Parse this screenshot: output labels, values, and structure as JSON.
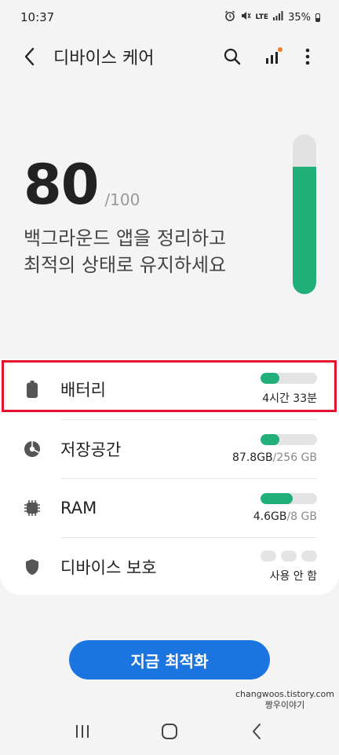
{
  "status_bar": {
    "time": "10:37",
    "network": "LTE",
    "battery_percent": "35%",
    "icons": [
      "alarm-icon",
      "mute-icon",
      "lte-icon",
      "signal-icon",
      "battery-icon"
    ]
  },
  "app_bar": {
    "title": "디바이스 케어",
    "icons": [
      "back-icon",
      "search-icon",
      "stats-icon",
      "more-vert-icon"
    ]
  },
  "score": {
    "value": "80",
    "max": "/100",
    "gauge_fraction": 0.8,
    "gauge_color": "#21b07a",
    "description_line1": "백그라운드 앱을 정리하고",
    "description_line2": "최적의 상태로 유지하세요"
  },
  "items": [
    {
      "label": "배터리",
      "icon": "battery-icon",
      "value": "4시간 33분",
      "value_sub": "",
      "level": 0.33
    },
    {
      "label": "저장공간",
      "icon": "storage-pie-icon",
      "value": "87.8GB",
      "value_sub": "/256 GB",
      "level": 0.34
    },
    {
      "label": "RAM",
      "icon": "ram-chip-icon",
      "value": "4.6GB",
      "value_sub": "/8 GB",
      "level": 0.57
    },
    {
      "label": "디바이스 보호",
      "icon": "shield-icon",
      "value": "사용 안 함",
      "value_sub": "",
      "level": 0
    }
  ],
  "optimize_button": {
    "label": "지금 최적화",
    "color": "#1b75e0"
  },
  "watermark": {
    "line1": "changwoos.tistory.com",
    "line2": "짱우이야기"
  },
  "highlight_color": "#e8112d",
  "nav_bar": {
    "icons": [
      "recents-icon",
      "home-icon",
      "back-nav-icon"
    ]
  }
}
